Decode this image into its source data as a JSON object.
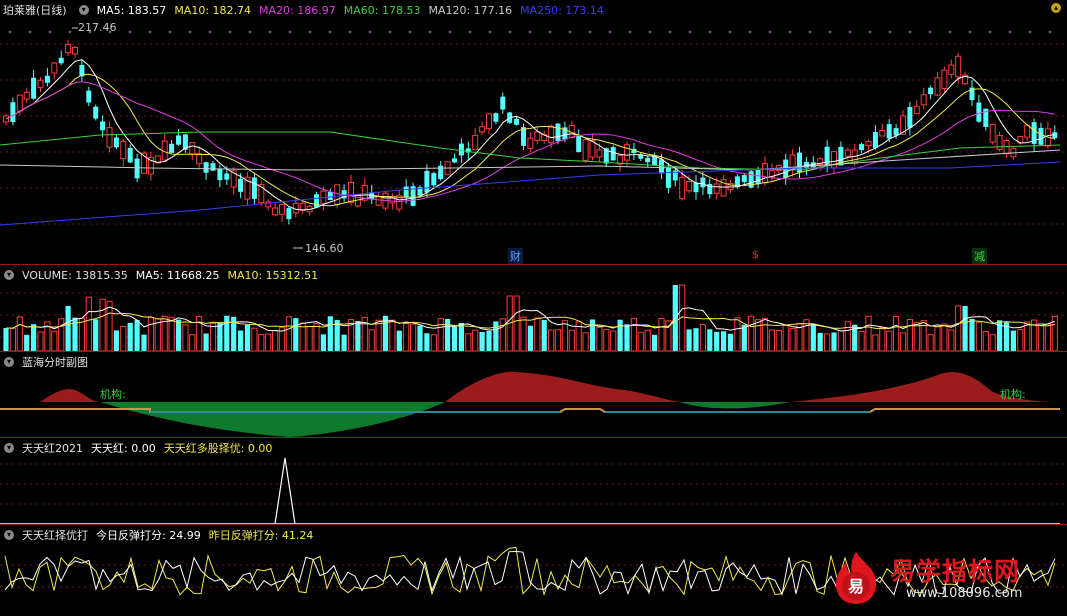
{
  "main": {
    "title": "珀莱雅(日线)",
    "ma": [
      {
        "label": "MA5: 183.57",
        "color": "#ffffff"
      },
      {
        "label": "MA10: 182.74",
        "color": "#f2e84a"
      },
      {
        "label": "MA20: 186.97",
        "color": "#e03ce0"
      },
      {
        "label": "MA60: 178.53",
        "color": "#3ad33a"
      },
      {
        "label": "MA120: 177.16",
        "color": "#c8c8c8"
      },
      {
        "label": "MA250: 173.14",
        "color": "#3a3aff"
      }
    ],
    "high_label": "217.46",
    "low_label": "146.60",
    "markers": [
      {
        "text": "财",
        "color": "#5aa0ff"
      },
      {
        "text": "$",
        "color": "#e03030"
      },
      {
        "text": "减",
        "color": "#3ad33a"
      }
    ]
  },
  "volume": {
    "title": "VOLUME: 13815.35",
    "ma5": "MA5: 11668.25",
    "ma10": "MA10: 15312.51",
    "colors": {
      "up": "#ff3b3b",
      "down": "#54ffff",
      "ma5": "#ffffff",
      "ma10": "#f2e84a"
    }
  },
  "lanhai": {
    "title": "蓝海分时副图",
    "label1": "机构:",
    "label2": "机构:"
  },
  "tth": {
    "title": "天天红2021",
    "v1": "天天红: 0.00",
    "v2": "天天红多股择优: 0.00"
  },
  "ttd": {
    "title": "天天红择优打",
    "v1": "今日反弹打分: 24.99",
    "v2": "昨日反弹打分: 41.24"
  },
  "watermark": {
    "brand": "易学指标网",
    "url": "www.108096.com",
    "glyph": "易"
  },
  "icons": {
    "collapse": "circle-chevron-icon",
    "settings": "gear-icon"
  }
}
